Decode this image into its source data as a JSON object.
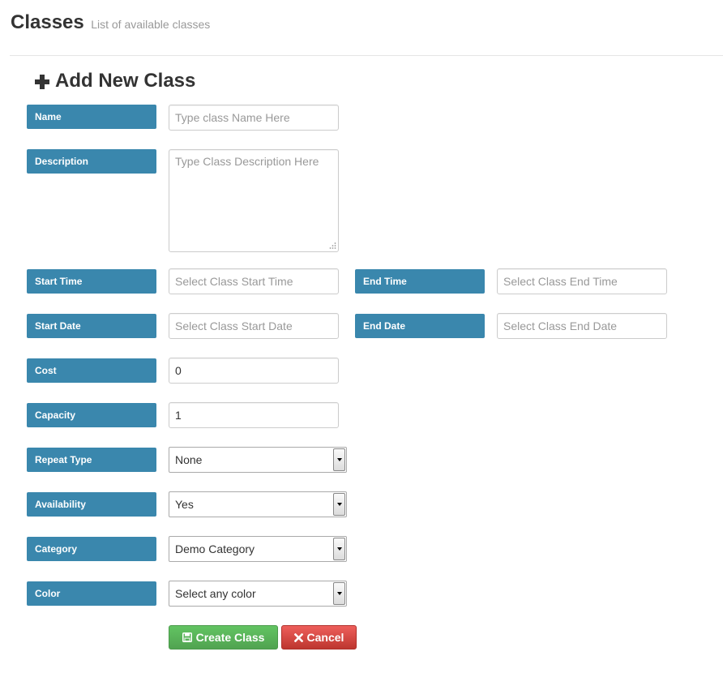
{
  "header": {
    "title": "Classes",
    "subtitle": "List of available classes"
  },
  "form": {
    "title": "Add New Class",
    "title_icon": "plus-icon",
    "fields": {
      "name": {
        "label": "Name",
        "placeholder": "Type class Name Here",
        "value": ""
      },
      "description": {
        "label": "Description",
        "placeholder": "Type Class Description Here",
        "value": ""
      },
      "start_time": {
        "label": "Start Time",
        "placeholder": "Select Class Start Time",
        "value": ""
      },
      "end_time": {
        "label": "End Time",
        "placeholder": "Select Class End Time",
        "value": ""
      },
      "start_date": {
        "label": "Start Date",
        "placeholder": "Select Class Start Date",
        "value": ""
      },
      "end_date": {
        "label": "End Date",
        "placeholder": "Select Class End Date",
        "value": ""
      },
      "cost": {
        "label": "Cost",
        "value": "0"
      },
      "capacity": {
        "label": "Capacity",
        "value": "1"
      },
      "repeat_type": {
        "label": "Repeat Type",
        "selected": "None"
      },
      "availability": {
        "label": "Availability",
        "selected": "Yes"
      },
      "category": {
        "label": "Category",
        "selected": "Demo Category"
      },
      "color": {
        "label": "Color",
        "selected": "Select any color"
      }
    },
    "buttons": {
      "create_label": "Create Class",
      "create_icon": "save-icon",
      "cancel_label": "Cancel",
      "cancel_icon": "close-icon"
    }
  },
  "colors": {
    "label_bg": "#3a87ad",
    "success": "#5bb75b",
    "danger": "#da4f49"
  }
}
